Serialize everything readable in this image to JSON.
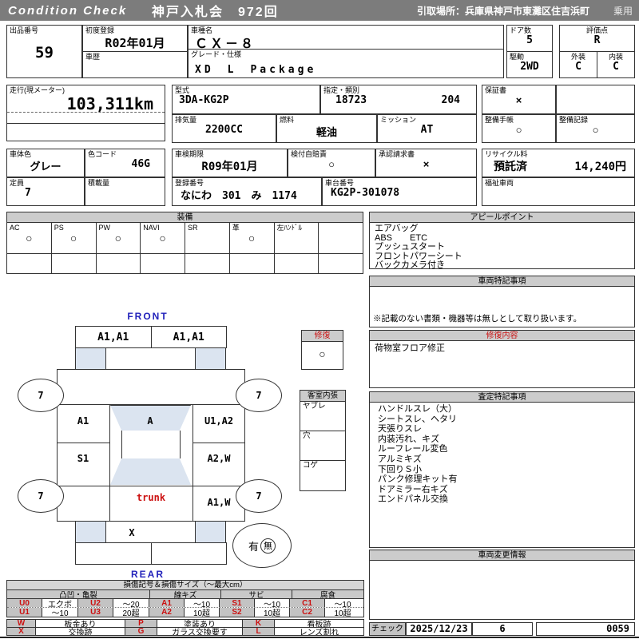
{
  "header": {
    "brand": "Condition  Check",
    "auction": "神戸入札会　972回",
    "pickup": "引取場所：兵庫県神戸市東灘区住吉浜町",
    "vehicle_class": "乗用"
  },
  "fields": {
    "lot": {
      "label": "出品番号",
      "value": "59"
    },
    "first_reg": {
      "label": "初度登録",
      "value": "R02年01月"
    },
    "history": {
      "label": "車歴",
      "value": ""
    },
    "model": {
      "label": "車種名",
      "value": "ＣＸ－８"
    },
    "grade": {
      "label": "グレード・仕様",
      "value": "XD　L　Package"
    },
    "doors": {
      "label": "ドア数",
      "value": "5"
    },
    "drive": {
      "label": "駆動",
      "value": "2WD"
    },
    "score": {
      "label": "評価点",
      "value": "R"
    },
    "exterior": {
      "label": "外装",
      "value": "C"
    },
    "interior": {
      "label": "内装",
      "value": "C"
    },
    "mileage": {
      "label": "走行(現メーター)",
      "value": "103,311km"
    },
    "model_code": {
      "label": "型式",
      "value": "3DA-KG2P"
    },
    "type_class": {
      "label": "指定・類別",
      "value1": "18723",
      "value2": "204"
    },
    "displacement": {
      "label": "排気量",
      "value": "2200CC"
    },
    "fuel": {
      "label": "燃料",
      "value": "軽油"
    },
    "transmission": {
      "label": "ミッション",
      "value": "AT"
    },
    "warranty": {
      "label": "保証書",
      "value": "×"
    },
    "maintenance_book": {
      "label": "整備手帳",
      "value": "○"
    },
    "maintenance_record": {
      "label": "整備記録",
      "value": "○"
    },
    "body_color": {
      "label": "車体色",
      "value": "グレー"
    },
    "color_code": {
      "label": "色コード",
      "value": "46G"
    },
    "capacity": {
      "label": "定員",
      "value": "7"
    },
    "load": {
      "label": "積載量",
      "value": ""
    },
    "inspection": {
      "label": "車検期限",
      "value": "R09年01月"
    },
    "insurance": {
      "label": "検付自賠責",
      "value": "○"
    },
    "approval": {
      "label": "承認請求書",
      "value": "×"
    },
    "reg_no": {
      "label": "登録番号",
      "value": "なにわ　301　み　1174"
    },
    "chassis": {
      "label": "車台番号",
      "value": "KG2P-301078"
    },
    "recycle": {
      "label": "リサイクル料",
      "status": "預託済",
      "fee": "14,240円"
    },
    "welfare": {
      "label": "福祉車両",
      "value": ""
    }
  },
  "equipment": {
    "title": "装備",
    "items": [
      {
        "label": "AC",
        "mark": "○"
      },
      {
        "label": "PS",
        "mark": "○"
      },
      {
        "label": "PW",
        "mark": "○"
      },
      {
        "label": "NAVI",
        "mark": "○"
      },
      {
        "label": "SR",
        "mark": ""
      },
      {
        "label": "革",
        "mark": "○"
      },
      {
        "label": "左ﾊﾝﾄﾞﾙ",
        "mark": ""
      },
      {
        "label": "",
        "mark": ""
      }
    ]
  },
  "appeal": {
    "title": "アピールポイント",
    "lines": [
      "エアバッグ",
      "ABS　　ETC",
      "プッシュスタート",
      "フロントパワーシート",
      "バックカメラ付き"
    ]
  },
  "special_notes": {
    "title": "車両特記事項",
    "note": "※記載のない書類・機器等は無しとして取り扱います。"
  },
  "repair_info": {
    "title": "修復内容",
    "lines": [
      "荷物室フロア修正"
    ]
  },
  "assessment": {
    "title": "査定特記事項",
    "lines": [
      "ハンドルスレ（大）",
      "シートスレ、ヘタリ",
      "天張りスレ",
      "内装汚れ、キズ",
      "ルーフレール変色",
      "アルミキズ",
      "下回りＳ小",
      "パンク修理キット有",
      "ドアミラー右キズ",
      "エンドパネル交換"
    ]
  },
  "change_info": {
    "title": "車両変更情報"
  },
  "check": {
    "label": "チェック",
    "date": "2025/12/23",
    "code": "6",
    "number": "0059"
  },
  "diagram": {
    "front_label": "FRONT",
    "rear_label": "REAR",
    "front_bumper_left": "A1,A1",
    "front_bumper_right": "A1,A1",
    "wheel_front_left": "7",
    "wheel_front_right": "7",
    "wheel_rear_left": "7",
    "wheel_rear_right": "7",
    "left_front_door": "A1",
    "windshield": "A",
    "right_front_door": "U1,A2",
    "left_rear_door": "S1",
    "right_rear_door": "A2,W",
    "trunk": "trunk",
    "right_quarter": "A1,W",
    "rear_panel": "X",
    "spare_yes": "有",
    "spare_no": "無",
    "repair_box": {
      "title": "修復",
      "mark": "○"
    },
    "interior_box": {
      "title": "客室内張",
      "rows": [
        "ヤブレ",
        "穴",
        "コゲ"
      ]
    }
  },
  "legend": {
    "title": "損傷記号＆損傷サイズ（～最大cm）",
    "groups": [
      "凸凹・亀裂",
      "線キズ",
      "サビ",
      "腐食"
    ],
    "rows": [
      [
        "U0",
        "エクボ",
        "U2",
        "～20",
        "A1",
        "～10",
        "S1",
        "～10",
        "C1",
        "～10"
      ],
      [
        "U1",
        "～10",
        "U3",
        "20超",
        "A2",
        "10超",
        "S2",
        "10超",
        "C2",
        "10超"
      ]
    ],
    "rows2": [
      [
        "W",
        "板金あり",
        "P",
        "塗装あり",
        "K",
        "看板跡"
      ],
      [
        "X",
        "交換跡",
        "G",
        "ガラス交換要す",
        "L",
        "レンズ割れ"
      ]
    ]
  }
}
